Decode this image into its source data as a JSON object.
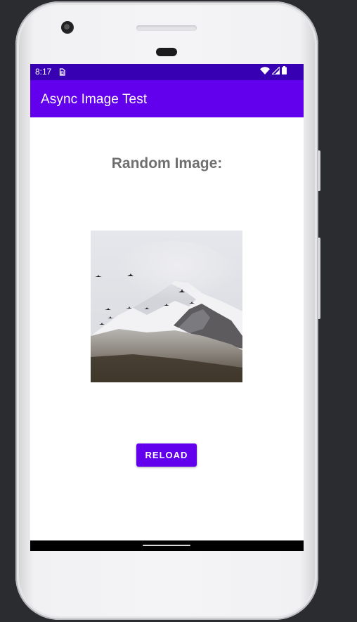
{
  "status_bar": {
    "time": "8:17",
    "sim_icon": "sim-card-icon",
    "icons": [
      "wifi-icon",
      "signal-icon",
      "battery-icon"
    ],
    "color": "#3700b3"
  },
  "app_bar": {
    "title": "Async Image Test",
    "color": "#6200ee"
  },
  "content": {
    "heading": "Random Image:",
    "image_alt": "snowy-mountain-photo-with-birds"
  },
  "actions": {
    "reload_label": "RELOAD",
    "accent": "#6200ee"
  }
}
